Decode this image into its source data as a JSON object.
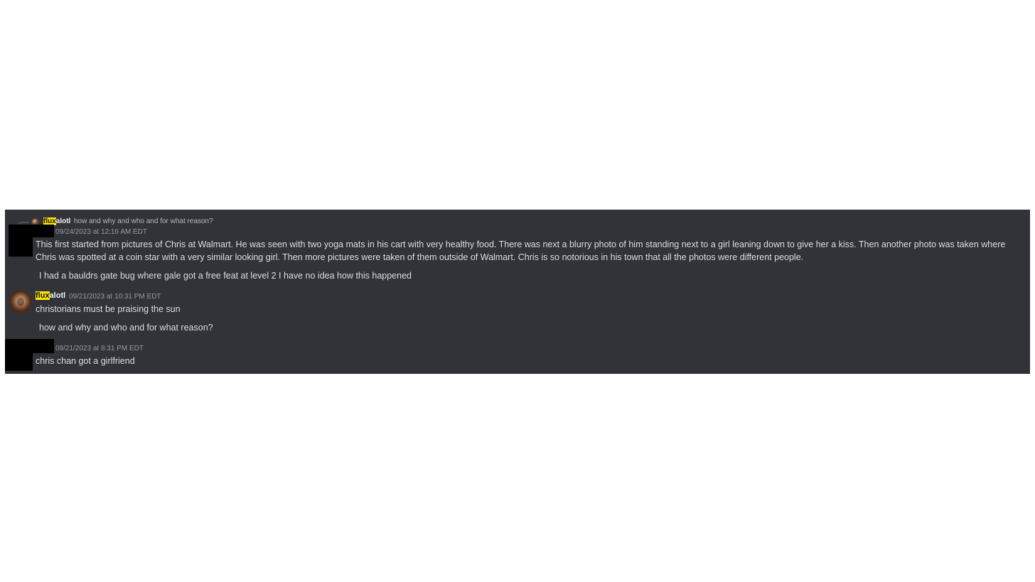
{
  "reply": {
    "username_highlight": "flux",
    "username_rest": "alotl",
    "text": "how and why and who and for what reason?"
  },
  "messages": [
    {
      "timestamp": "09/24/2023 at 12:16 AM EDT",
      "text": "This first started from pictures of Chris at Walmart. He was seen with two yoga mats in his cart with very healthy food. There was next a blurry photo of him standing next to a girl leaning down to give her a kiss. Then another photo was taken where Chris was spotted at a coin star with a very similar looking girl. Then more pictures were taken of them outside of Walmart. Chris is so notorious in his town that all the photos were different people.",
      "followup": "I had a bauldrs gate bug where gale got a free feat at level 2 I have no idea how this happened"
    },
    {
      "username_highlight": "flux",
      "username_rest": "alotl",
      "timestamp": "09/21/2023 at 10:31 PM EDT",
      "text": "christorians must be praising the sun",
      "followup": "how and why and who and for what reason?"
    },
    {
      "timestamp": "09/21/2023 at 8:31 PM EDT",
      "text": "chris chan got a girlfriend"
    }
  ],
  "colors": {
    "background": "#313338",
    "highlight": "#ffe500",
    "text": "#e3e5e8",
    "muted": "#949ba4"
  }
}
